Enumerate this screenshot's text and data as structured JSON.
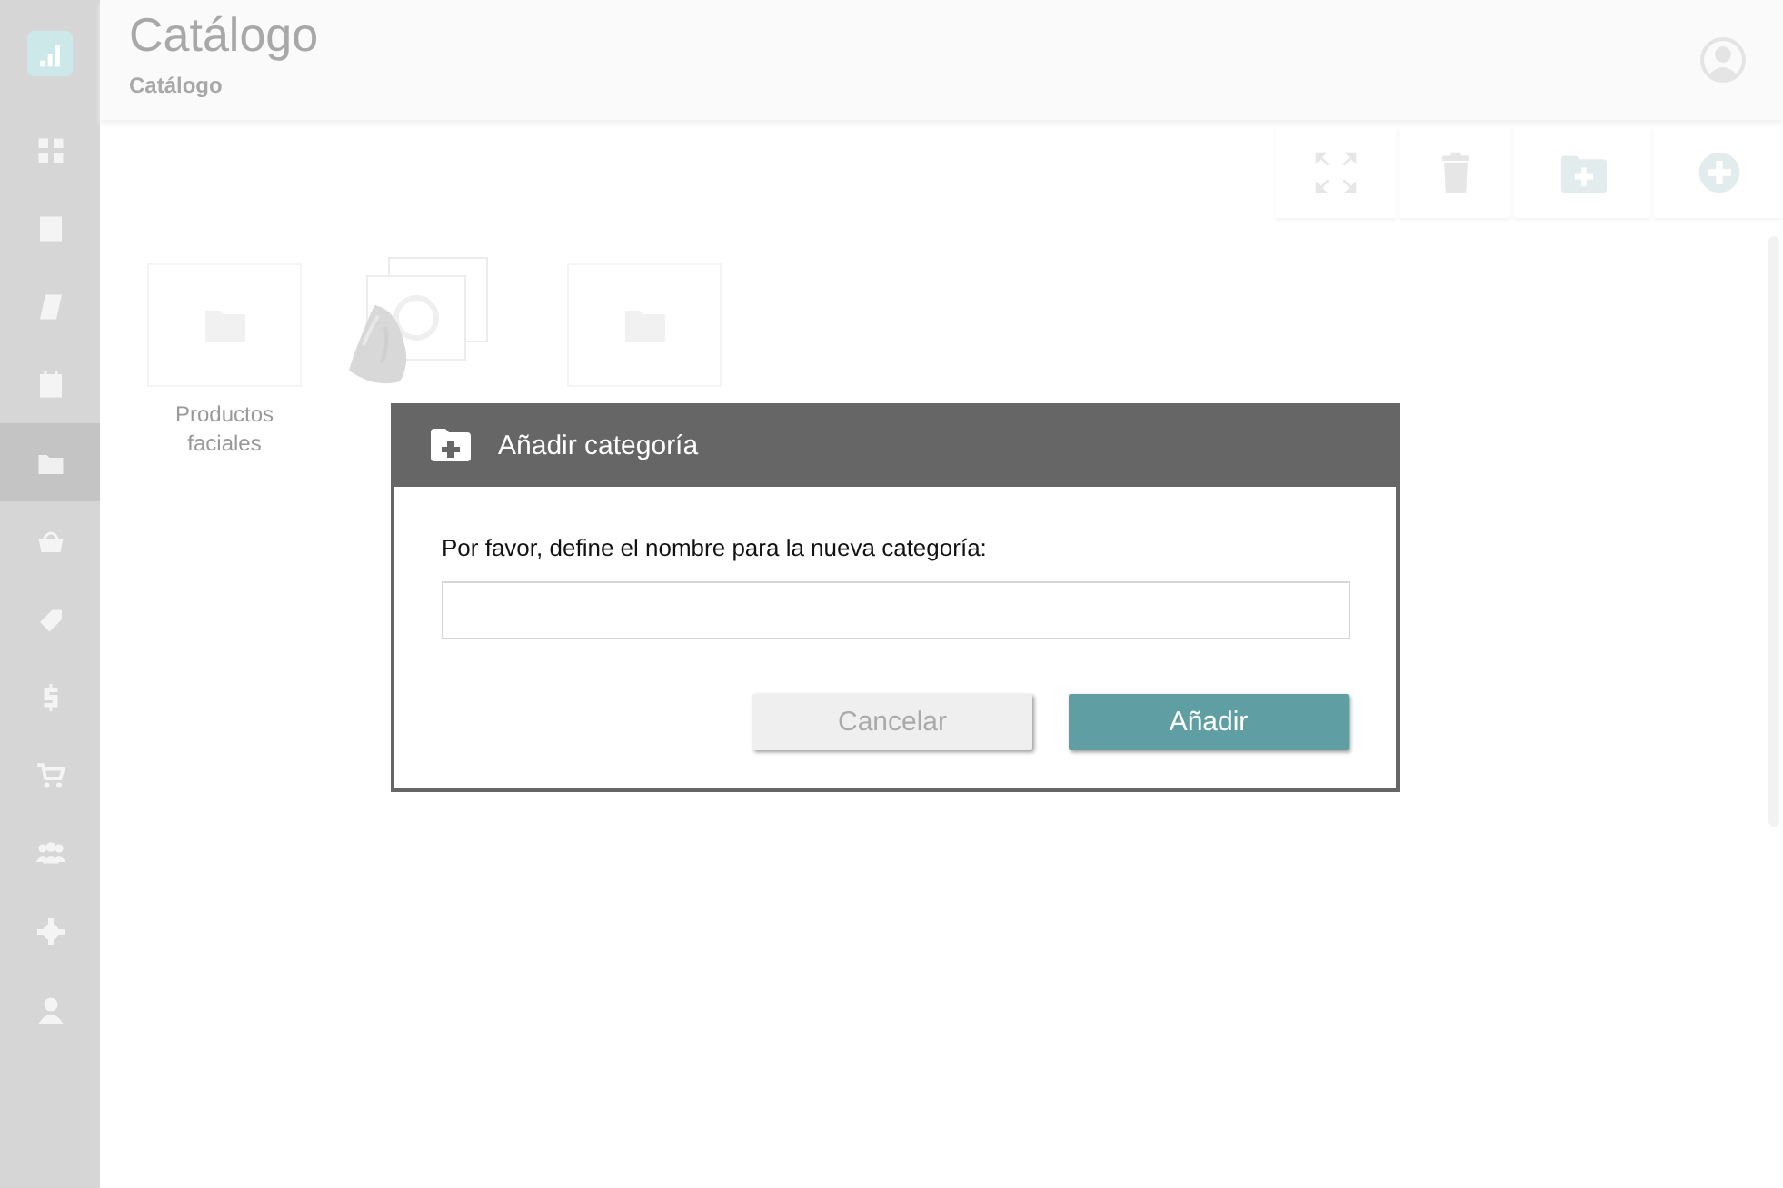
{
  "sidebar": {
    "items": [
      {
        "selected": false
      },
      {
        "selected": false
      },
      {
        "selected": false
      },
      {
        "selected": false
      },
      {
        "selected": true
      },
      {
        "selected": false
      },
      {
        "selected": false
      },
      {
        "selected": false
      },
      {
        "selected": false
      },
      {
        "selected": false
      },
      {
        "selected": false
      },
      {
        "selected": false
      }
    ]
  },
  "header": {
    "title": "Catálogo",
    "breadcrumb": "Catálogo"
  },
  "tiles": [
    {
      "kind": "folder",
      "label": "Productos faciales"
    },
    {
      "kind": "dragging"
    },
    {
      "kind": "folder"
    }
  ],
  "dialog": {
    "title": "Añadir categoría",
    "prompt": "Por favor, define el nombre para la nueva categoría:",
    "buttons": [
      {
        "label": "Cancelar",
        "kind": "secondary"
      },
      {
        "label": "Añadir",
        "kind": "primary"
      }
    ]
  }
}
